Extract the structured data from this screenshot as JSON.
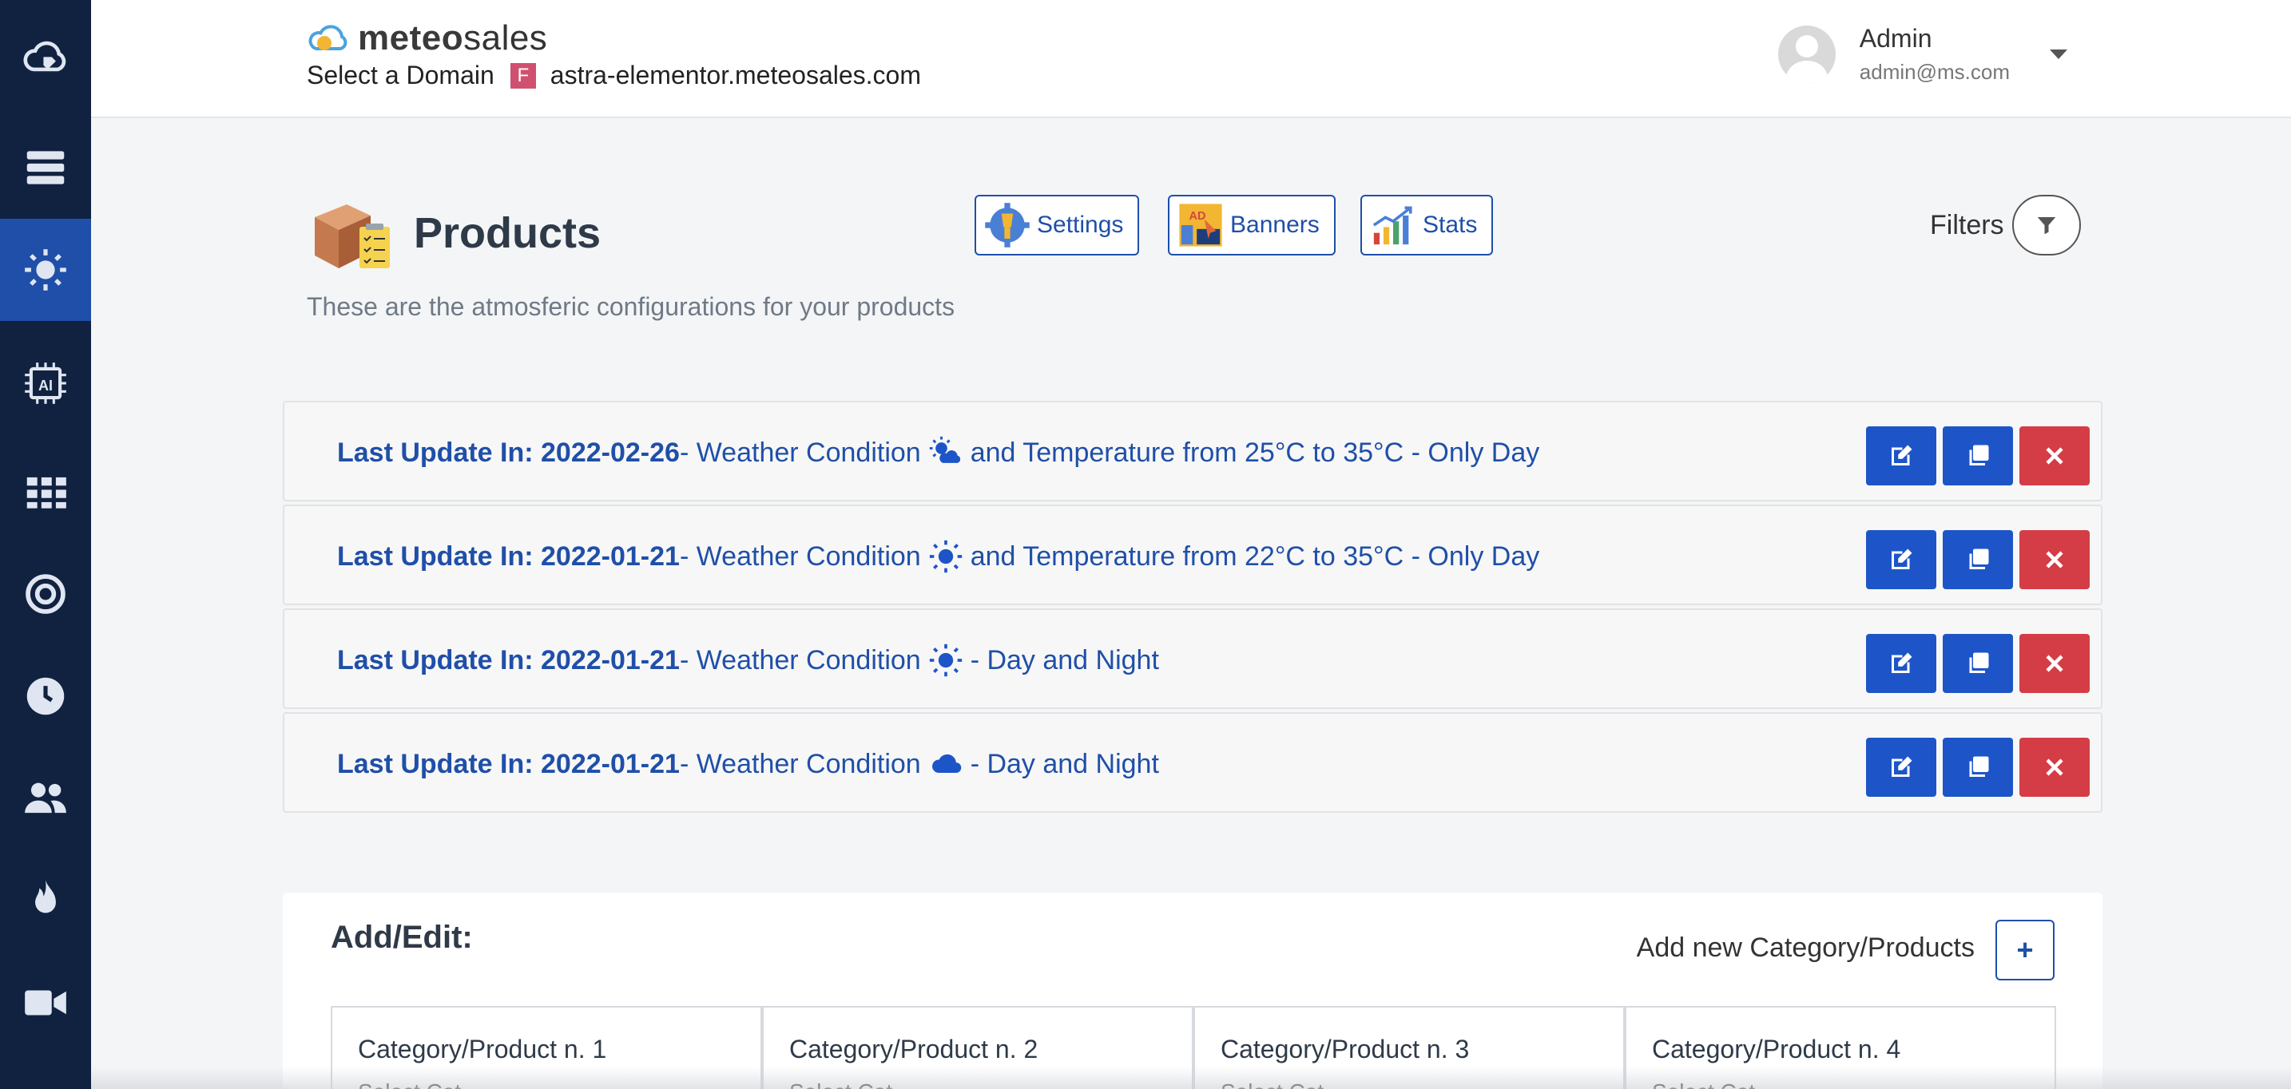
{
  "sidebar": {
    "items": [
      {
        "icon": "cloud-tag-icon"
      },
      {
        "icon": "server-icon"
      },
      {
        "icon": "sun-icon",
        "active": true
      },
      {
        "icon": "ai-chip-icon"
      },
      {
        "icon": "grid-icon"
      },
      {
        "icon": "target-icon"
      },
      {
        "icon": "clock-icon"
      },
      {
        "icon": "users-icon"
      },
      {
        "icon": "fire-icon"
      },
      {
        "icon": "video-icon"
      }
    ]
  },
  "header": {
    "logo_bold": "meteo",
    "logo_light": "sales",
    "domain_label": "Select a Domain",
    "domain_badge": "F",
    "domain_value": "astra-elementor.meteosales.com",
    "user_name": "Admin",
    "user_email": "admin@ms.com"
  },
  "page": {
    "title": "Products",
    "subtitle": "These are the atmosferic configurations for your products",
    "tools": {
      "settings": "Settings",
      "banners": "Banners",
      "stats": "Stats"
    },
    "filters_label": "Filters"
  },
  "configs": [
    {
      "date_label": "Last Update In: 2022-02-26",
      "pre": " - Weather Condition",
      "icon": "sun-cloud-icon",
      "post": "and Temperature from 25°C to 35°C - Only Day"
    },
    {
      "date_label": "Last Update In: 2022-01-21",
      "pre": " - Weather Condition",
      "icon": "sun-icon",
      "post": "and Temperature from 22°C to 35°C - Only Day"
    },
    {
      "date_label": "Last Update In: 2022-01-21",
      "pre": " - Weather Condition",
      "icon": "sun-icon",
      "post": "- Day and Night"
    },
    {
      "date_label": "Last Update In: 2022-01-21",
      "pre": " - Weather Condition",
      "icon": "cloud-icon",
      "post": "- Day and Night"
    }
  ],
  "panel": {
    "title": "Add/Edit:",
    "add_label": "Add new Category/Products",
    "add_button": "+",
    "cards": [
      {
        "title": "Category/Product n. 1",
        "sub": "Select Cat..."
      },
      {
        "title": "Category/Product n. 2",
        "sub": "Select Cat..."
      },
      {
        "title": "Category/Product n. 3",
        "sub": "Select Cat..."
      },
      {
        "title": "Category/Product n. 4",
        "sub": "Select Cat..."
      }
    ]
  },
  "colors": {
    "sidebar_bg": "#112240",
    "sidebar_active": "#1f4fa8",
    "accent_blue": "#1d55c8",
    "danger_red": "#d43d46"
  }
}
